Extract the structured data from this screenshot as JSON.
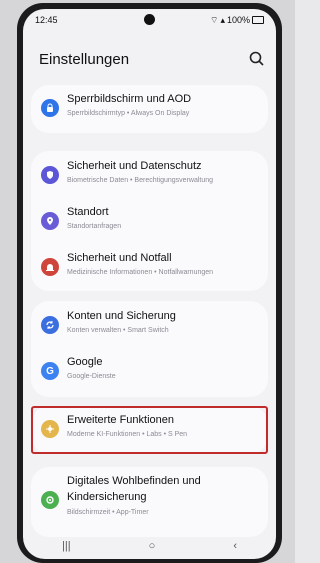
{
  "status": {
    "time": "12:45",
    "battery": "100%",
    "wifi_icon": "wifi-icon",
    "signal_icon": "signal-icon",
    "battery_icon": "battery-icon"
  },
  "header": {
    "title": "Einstellungen",
    "search_icon": "search-icon"
  },
  "sections": [
    {
      "items": [
        {
          "label": "Sperrbildschirm und AOD",
          "sub": "Sperrbildschirmtyp • Always On Display",
          "icon": "lock-icon",
          "color": "#2f74e8"
        }
      ]
    },
    {
      "items": [
        {
          "label": "Sicherheit und Datenschutz",
          "sub": "Biometrische Daten • Berechtigungsverwaltung",
          "icon": "shield-icon",
          "color": "#5b57d6"
        },
        {
          "label": "Standort",
          "sub": "Standortanfragen",
          "icon": "location-icon",
          "color": "#6a5bd7"
        },
        {
          "label": "Sicherheit und Notfall",
          "sub": "Medizinische Informationen • Notfallwarnungen",
          "icon": "emergency-icon",
          "color": "#d0453b"
        }
      ]
    },
    {
      "items": [
        {
          "label": "Konten und Sicherung",
          "sub": "Konten verwalten • Smart Switch",
          "icon": "sync-icon",
          "color": "#3b6fe0"
        },
        {
          "label": "Google",
          "sub": "Google-Dienste",
          "icon": "google-icon",
          "color": "#3c82f0"
        }
      ]
    },
    {
      "items": [
        {
          "label": "Erweiterte Funktionen",
          "sub": "Moderne KI-Funktionen • Labs • S Pen",
          "icon": "advanced-features-icon",
          "color": "#e3b54a"
        }
      ]
    },
    {
      "items": [
        {
          "label": "Digitales Wohlbefinden und",
          "label2": "Kindersicherung",
          "sub": "Bildschirmzeit • App-Timer",
          "icon": "wellbeing-icon",
          "color": "#4caf50"
        }
      ]
    }
  ],
  "nav": {
    "recent": "|||",
    "home": "○",
    "back": "‹"
  }
}
